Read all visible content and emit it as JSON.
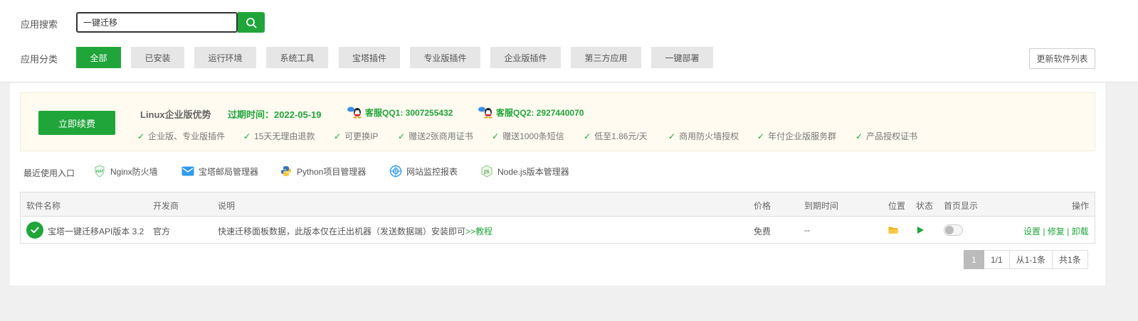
{
  "search": {
    "label": "应用搜索",
    "value": "一键迁移"
  },
  "categories": {
    "label": "应用分类",
    "items": [
      "全部",
      "已安装",
      "运行环境",
      "系统工具",
      "宝塔插件",
      "专业版插件",
      "企业版插件",
      "第三方应用",
      "一键部署"
    ],
    "active": "全部"
  },
  "refresh_label": "更新软件列表",
  "promo": {
    "renew_label": "立即续费",
    "title": "Linux企业版优势",
    "expire": "过期时间：2022-05-19",
    "qq1": "客服QQ1: 3007255432",
    "qq2": "客服QQ2: 2927440070",
    "perks": [
      "企业版、专业版插件",
      "15天无理由退款",
      "可更换IP",
      "赠送2张商用证书",
      "赠送1000条短信",
      "低至1.86元/天",
      "商用防火墙授权",
      "年付企业版服务群",
      "产品授权证书"
    ]
  },
  "recent": {
    "label": "最近使用入口",
    "items": [
      "Nginx防火墙",
      "宝塔邮局管理器",
      "Python项目管理器",
      "网站监控报表",
      "Node.js版本管理器"
    ]
  },
  "table": {
    "headers": {
      "name": "软件名称",
      "dev": "开发商",
      "desc": "说明",
      "price": "价格",
      "expire": "到期时间",
      "location": "位置",
      "status": "状态",
      "homepage": "首页显示",
      "ops": "操作"
    },
    "rows": [
      {
        "name": "宝塔一键迁移API版本 3.2",
        "dev": "官方",
        "desc": "快速迁移面板数据，此版本仅在迁出机器（发送数据端）安装即可",
        "tutorial": ">>教程",
        "price": "免费",
        "expire": "--",
        "homepage_on": false,
        "op_settings": "设置",
        "op_repair": "修复",
        "op_uninstall": "卸载",
        "sep": "|"
      }
    ]
  },
  "pagination": {
    "current": "1",
    "pages": "1/1",
    "range": "从1-1条",
    "total": "共1条"
  },
  "colors": {
    "accent": "#20a53a",
    "promo_bg": "#fffbf0"
  },
  "icons": {
    "search": "search-icon",
    "check": "check-icon",
    "qq": "qq-icon",
    "folder": "folder-icon",
    "play": "play-icon"
  }
}
